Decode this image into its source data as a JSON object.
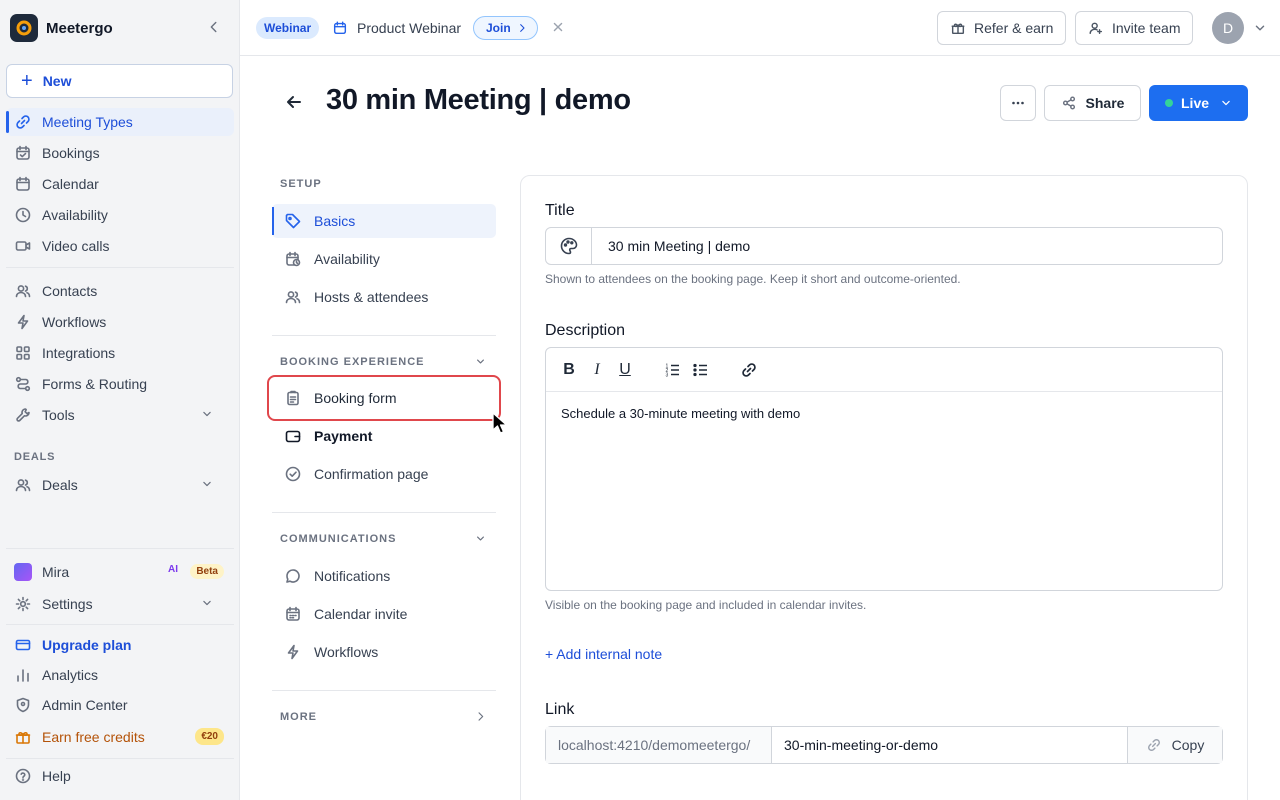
{
  "app": {
    "name": "Meetergo"
  },
  "sidebar": {
    "new_label": "New",
    "items": [
      {
        "label": "Meeting Types",
        "icon": "link-icon"
      },
      {
        "label": "Bookings",
        "icon": "calendar-check-icon"
      },
      {
        "label": "Calendar",
        "icon": "calendar-icon"
      },
      {
        "label": "Availability",
        "icon": "clock-icon"
      },
      {
        "label": "Video calls",
        "icon": "video-icon"
      },
      {
        "label": "Contacts",
        "icon": "users-icon"
      },
      {
        "label": "Workflows",
        "icon": "lightning-icon"
      },
      {
        "label": "Integrations",
        "icon": "grid-icon"
      },
      {
        "label": "Forms & Routing",
        "icon": "route-icon"
      },
      {
        "label": "Tools",
        "icon": "wrench-icon"
      }
    ],
    "deals_section": "DEALS",
    "deals_label": "Deals",
    "bottom": {
      "mira": "Mira",
      "ai_badge": "AI",
      "beta_badge": "Beta",
      "settings": "Settings",
      "upgrade": "Upgrade plan",
      "analytics": "Analytics",
      "admin": "Admin Center",
      "credits": "Earn free credits",
      "credits_badge": "€20",
      "help": "Help"
    }
  },
  "topbar": {
    "webinar_badge": "Webinar",
    "webinar_title": "Product Webinar",
    "join_label": "Join",
    "refer_label": "Refer & earn",
    "invite_label": "Invite team",
    "avatar_initial": "D"
  },
  "header": {
    "title": "30 min Meeting | demo",
    "share_label": "Share",
    "live_label": "Live"
  },
  "settings_nav": {
    "setup_label": "SETUP",
    "setup_items": [
      "Basics",
      "Availability",
      "Hosts & attendees"
    ],
    "booking_label": "BOOKING EXPERIENCE",
    "booking_items": [
      "Booking form",
      "Payment",
      "Confirmation page"
    ],
    "comms_label": "COMMUNICATIONS",
    "comms_items": [
      "Notifications",
      "Calendar invite",
      "Workflows"
    ],
    "more_label": "MORE"
  },
  "form": {
    "title_label": "Title",
    "title_value": "30 min Meeting | demo",
    "title_hint": "Shown to attendees on the booking page. Keep it short and outcome-oriented.",
    "description_label": "Description",
    "toolbar": {
      "bold": "B",
      "italic": "I",
      "underline": "U"
    },
    "description_value": "Schedule a 30-minute meeting with demo",
    "description_hint": "Visible on the booking page and included in calendar invites.",
    "add_note_label": "+ Add internal note",
    "link_label": "Link",
    "link_prefix": "localhost:4210/demomeetergo/",
    "link_slug": "30-min-meeting-or-demo",
    "copy_label": "Copy"
  },
  "colors": {
    "accent": "#1d6ef0",
    "highlight": "#e0474c",
    "live_dot": "#34d399"
  }
}
